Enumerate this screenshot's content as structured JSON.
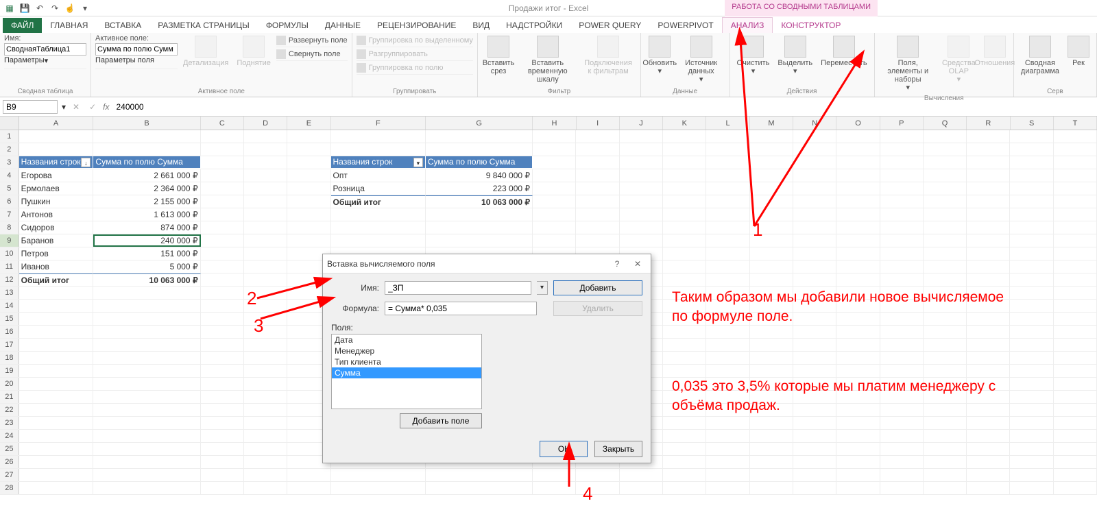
{
  "qat": {
    "title": "Продажи итог - Excel",
    "tools_tab": "РАБОТА СО СВОДНЫМИ ТАБЛИЦАМИ"
  },
  "tabs": {
    "file": "ФАЙЛ",
    "items": [
      "ГЛАВНАЯ",
      "ВСТАВКА",
      "РАЗМЕТКА СТРАНИЦЫ",
      "ФОРМУЛЫ",
      "ДАННЫЕ",
      "РЕЦЕНЗИРОВАНИЕ",
      "ВИД",
      "НАДСТРОЙКИ",
      "POWER QUERY",
      "POWERPIVOT"
    ],
    "analyze": "АНАЛИЗ",
    "construct": "КОНСТРУКТОР"
  },
  "ribbon": {
    "g1": {
      "name_label": "Имя:",
      "name_value": "СводнаяТаблица1",
      "params": "Параметры",
      "group": "Сводная таблица"
    },
    "g2": {
      "active_label": "Активное поле:",
      "active_value": "Сумма по полю Сумм",
      "field_params": "Параметры поля",
      "drilldown": "Детализация",
      "drillup": "Поднятие",
      "expand": "Развернуть поле",
      "collapse": "Свернуть поле",
      "group": "Активное поле"
    },
    "g3": {
      "a": "Группировка по выделенному",
      "b": "Разгруппировать",
      "c": "Группировка по полю",
      "group": "Группировать"
    },
    "g4": {
      "slicer": "Вставить срез",
      "timeline": "Вставить временную шкалу",
      "conns": "Подключения к фильтрам",
      "group": "Фильтр"
    },
    "g5": {
      "refresh": "Обновить",
      "source": "Источник данных",
      "group": "Данные"
    },
    "g6": {
      "clear": "Очистить",
      "select": "Выделить",
      "move": "Переместить",
      "group": "Действия"
    },
    "g7": {
      "fields": "Поля, элементы и наборы",
      "olap": "Средства OLAP",
      "rel": "Отношения",
      "group": "Вычисления"
    },
    "g8": {
      "chart": "Сводная диаграмма",
      "rec": "Рек",
      "group": "Серв"
    }
  },
  "fbar": {
    "name": "B9",
    "formula": "240000"
  },
  "cols": [
    "A",
    "B",
    "C",
    "D",
    "E",
    "F",
    "G",
    "H",
    "I",
    "J",
    "K",
    "L",
    "M",
    "N",
    "O",
    "P",
    "Q",
    "R",
    "S",
    "T"
  ],
  "pivot1": {
    "h1": "Названия строк",
    "h2": "Сумма по полю Сумма",
    "rows": [
      [
        "Егорова",
        "2 661 000 ₽"
      ],
      [
        "Ермолаев",
        "2 364 000 ₽"
      ],
      [
        "Пушкин",
        "2 155 000 ₽"
      ],
      [
        "Антонов",
        "1 613 000 ₽"
      ],
      [
        "Сидоров",
        "874 000 ₽"
      ],
      [
        "Баранов",
        "240 000 ₽"
      ],
      [
        "Петров",
        "151 000 ₽"
      ],
      [
        "Иванов",
        "5 000 ₽"
      ]
    ],
    "total_label": "Общий итог",
    "total_value": "10 063 000 ₽"
  },
  "pivot2": {
    "h1": "Названия строк",
    "h2": "Сумма по полю Сумма",
    "rows": [
      [
        "Опт",
        "9 840 000 ₽"
      ],
      [
        "Розница",
        "223 000 ₽"
      ]
    ],
    "total_label": "Общий итог",
    "total_value": "10 063 000 ₽"
  },
  "dialog": {
    "title": "Вставка вычисляемого поля",
    "name_label": "Имя:",
    "name_value": "_ЗП",
    "formula_label": "Формула:",
    "formula_value": "= Сумма* 0,035",
    "add": "Добавить",
    "delete": "Удалить",
    "fields_label": "Поля:",
    "fields": [
      "Дата",
      "Менеджер",
      "Тип клиента",
      "Сумма"
    ],
    "selected_field_index": 3,
    "add_field": "Добавить поле",
    "ok": "ОК",
    "close": "Закрыть"
  },
  "ann": {
    "n1": "1",
    "n2": "2",
    "n3": "3",
    "n4": "4",
    "text1": "Таким образом мы добавили новое вычисляемое по формуле поле.",
    "text2": "0,035 это 3,5% которые мы платим менеджеру с объёма продаж."
  }
}
